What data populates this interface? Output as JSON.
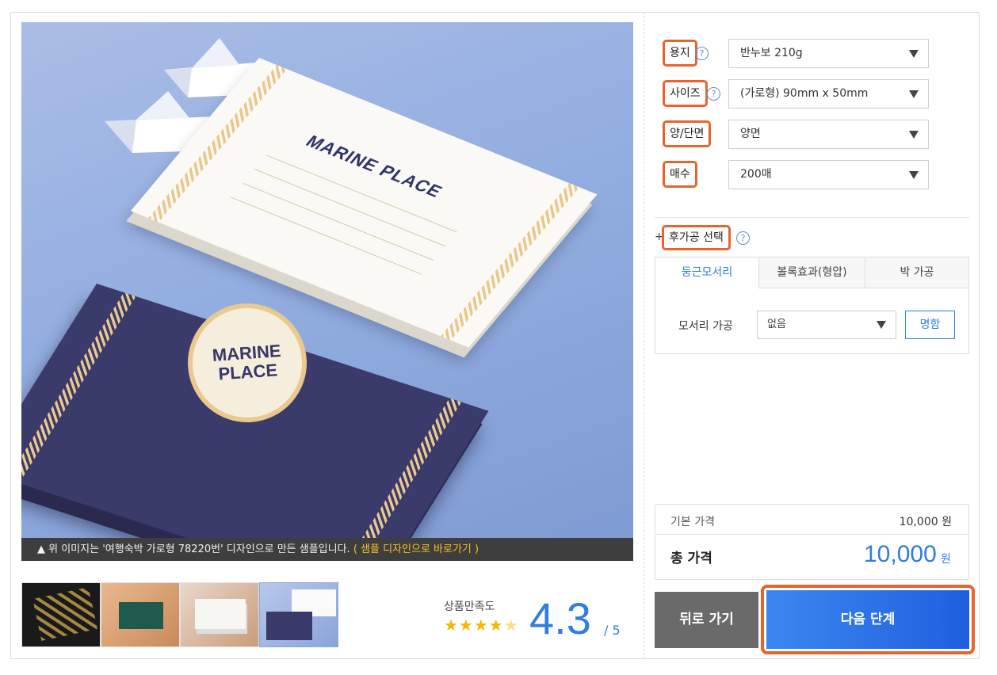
{
  "image_caption": {
    "text": "▲ 위 이미지는 '여행숙박 가로형 78220번' 디자인으로 만든 샘플입니다.",
    "link": "( 샘플 디자인으로 바로가기 )"
  },
  "hero_card": {
    "brand": "MARINE PLACE",
    "seal_line1": "MARINE",
    "seal_line2": "PLACE"
  },
  "thumbnails": [
    "black-gold-card",
    "green-card",
    "white-card",
    "navy-card"
  ],
  "rating": {
    "label": "상품만족도",
    "stars": "★★★★",
    "score": "4.3",
    "max": "/ 5"
  },
  "options": {
    "paper": {
      "label": "용지",
      "value": "반누보 210g"
    },
    "size": {
      "label": "사이즈",
      "value": "(가로형) 90mm x 50mm"
    },
    "sides": {
      "label": "양/단면",
      "value": "양면"
    },
    "quantity": {
      "label": "매수",
      "value": "200매"
    }
  },
  "post_processing": {
    "plus": "+",
    "label": "후가공 선택",
    "tabs": [
      "둥근모서리",
      "볼록효과(형압)",
      "박 가공"
    ],
    "corner_label": "모서리 가공",
    "corner_value": "없음",
    "name_button": "명함"
  },
  "help_icon": "?",
  "price": {
    "base_label": "기본 가격",
    "base_value": "10,000 원",
    "total_label": "총 가격",
    "total_value": "10,000",
    "total_unit": "원"
  },
  "buttons": {
    "back": "뒤로 가기",
    "next": "다음 단계"
  },
  "colors": {
    "accent_blue": "#2f7de1",
    "highlight_orange": "#e8642d",
    "caption_link": "#f7c32b"
  }
}
